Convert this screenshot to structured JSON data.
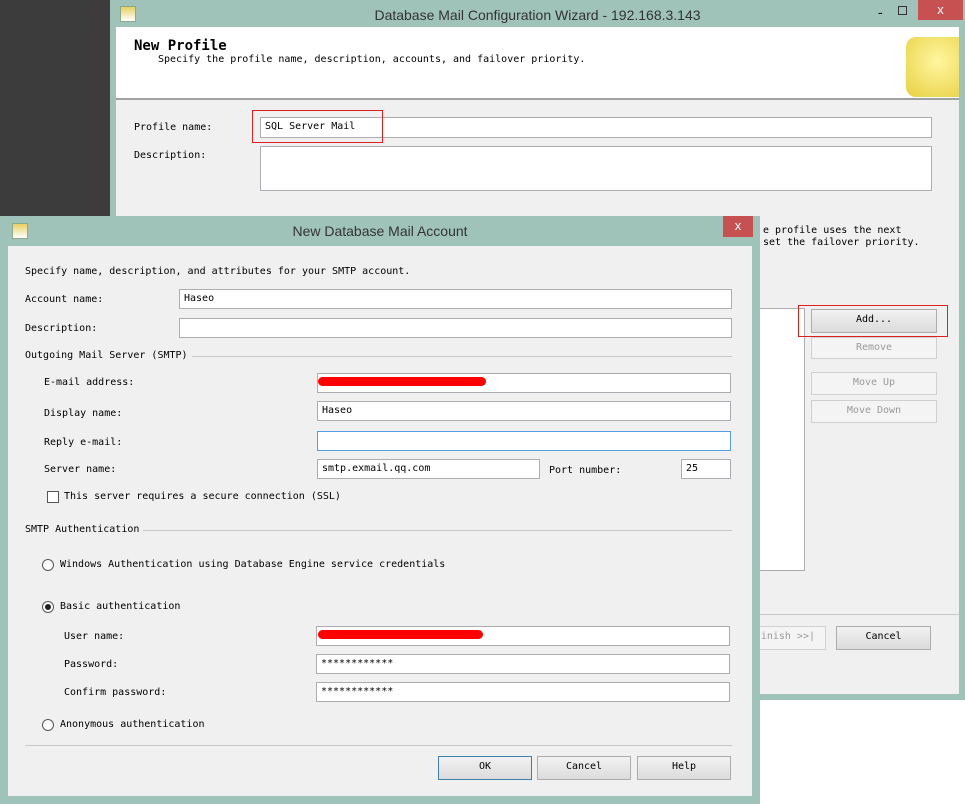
{
  "wizard": {
    "title": "Database Mail Configuration Wizard - 192.168.3.143",
    "header_title": "New Profile",
    "header_subtitle": "Specify the profile name, description, accounts, and failover priority.",
    "profile_name_label": "Profile name:",
    "profile_name_value": "SQL Server Mail",
    "description_label": "Description:",
    "description_value": "",
    "accounts_text_1": "e profile uses the next",
    "accounts_text_2": "set the failover priority.",
    "add_button": "Add...",
    "remove_button": "Remove",
    "move_up_button": "Move Up",
    "move_down_button": "Move Down",
    "finish_button": "inish >>|",
    "cancel_button": "Cancel",
    "minimize_icon": "minimize-icon",
    "maximize_icon": "maximize-icon",
    "close_icon": "close-icon",
    "close_glyph": "x"
  },
  "dialog": {
    "title": "New Database Mail Account",
    "close_glyph": "x",
    "intro": "Specify name, description, and attributes for your SMTP account.",
    "account_name_label": "Account name:",
    "account_name_value": "Haseo",
    "description_label": "Description:",
    "description_value": "",
    "smtp_group": "Outgoing Mail Server (SMTP)",
    "email_label": "E-mail address:",
    "email_value": "",
    "display_name_label": "Display name:",
    "display_name_value": "Haseo",
    "reply_label": "Reply e-mail:",
    "reply_value": "",
    "server_label": "Server name:",
    "server_value": "smtp.exmail.qq.com",
    "port_label": "Port number:",
    "port_value": "25",
    "ssl_label": "This server requires a secure connection (SSL)",
    "ssl_checked": false,
    "auth_group": "SMTP Authentication",
    "windows_auth_label": "Windows Authentication using Database Engine service credentials",
    "basic_auth_label": "Basic authentication",
    "selected_auth": "basic",
    "user_label": "User name:",
    "user_value": "",
    "password_label": "Password:",
    "password_value": "************",
    "confirm_label": "Confirm password:",
    "confirm_value": "************",
    "anon_auth_label": "Anonymous authentication",
    "ok_button": "OK",
    "cancel_button": "Cancel",
    "help_button": "Help"
  },
  "colors": {
    "frame": "#9fc3b9",
    "highlight": "#e02020",
    "redaction": "#ff0000"
  }
}
